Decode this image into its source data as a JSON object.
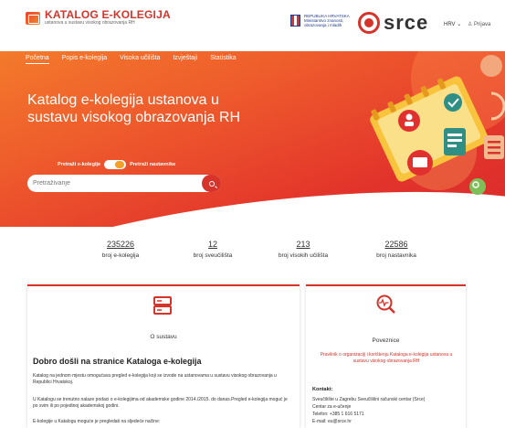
{
  "header": {
    "logo_title": "KATALOG E-KOLEGIJA",
    "logo_subtitle": "ustanova u sustavu visokog obrazovanja RH",
    "ministry": "REPUBLIKA HRVATSKA Ministarstvo znanosti, obrazovanja i mladih",
    "srce": "srce",
    "language": "HRV ⌄",
    "login": "♙ Prijava"
  },
  "nav": [
    {
      "label": "Početna"
    },
    {
      "label": "Popis e-kolegija"
    },
    {
      "label": "Visoka učilišta"
    },
    {
      "label": "Izvještaji"
    },
    {
      "label": "Statistika"
    }
  ],
  "hero": {
    "title": "Katalog e-kolegija ustanova u sustavu visokog obrazovanja RH",
    "toggle_left": "Pretraži e-kolegije",
    "toggle_right": "Pretraži nastavnike",
    "search_placeholder": "Pretraživanje"
  },
  "stats": [
    {
      "value": "235226",
      "label": "broj e-kolegija"
    },
    {
      "value": "12",
      "label": "broj sveučilišta"
    },
    {
      "value": "213",
      "label": "broj visokih učilišta"
    },
    {
      "value": "22586",
      "label": "broj nastavnika"
    }
  ],
  "about": {
    "title": "O sustavu",
    "heading": "Dobro došli na stranice Kataloga e-kolegija",
    "p1": "Katalog na jednom mjestu omogućava pregled e-kolegija koji se izvode na ustanovama u sustavu visokog obrazovanja u Republici Hrvatskoj.",
    "p2": "U Katalogu se trenutno nalaze podaci o e-kolegijima od akademske godine 2014./2015. do danas.Pregled e-kolegija moguć je po svim ili po pojedinoj akademskoj godini.",
    "p3": "E-kolegije u Katalogu moguće je pregledati na sljedeće načine:"
  },
  "links": {
    "title": "Poveznice",
    "link1": "Pravilnik o organizaciji i korištenju Kataloga e-kolegija ustanova u sustavu visokog obrazovanja RH",
    "contact_heading": "Kontakt:",
    "contact1": "Sveučilište u Zagrebu Sveučilišni računski centar (Srce)",
    "contact2": "Centar za e-učenje",
    "contact3": "Telefon: +385 1 616 5171",
    "contact4": "E-mail: eu@srce.hr"
  },
  "colors": {
    "accent": "#d6332a",
    "orange": "#f37a2b"
  }
}
